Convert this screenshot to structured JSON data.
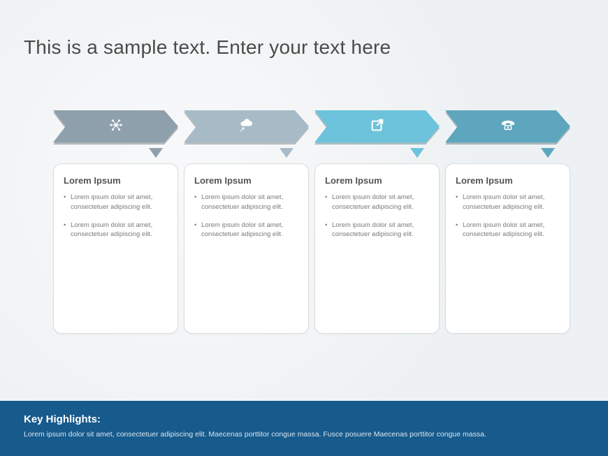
{
  "title": "This is a sample text. Enter your text here",
  "colors": {
    "step1": "#8ea0ab",
    "step2": "#a7bbc7",
    "step3": "#6cc3db",
    "step4": "#5ea6bd",
    "footer_bg": "#175a8c"
  },
  "steps": [
    {
      "icon": "network-icon",
      "heading": "Lorem Ipsum",
      "bullets": [
        "Lorem ipsum dolor sit amet, consectetuer adipiscing elit.",
        "Lorem ipsum dolor sit amet, consectetuer adipiscing elit."
      ]
    },
    {
      "icon": "thought-cloud-icon",
      "heading": "Lorem Ipsum",
      "bullets": [
        "Lorem ipsum dolor sit amet, consectetuer adipiscing elit.",
        "Lorem ipsum dolor sit amet, consectetuer adipiscing elit."
      ]
    },
    {
      "icon": "share-icon",
      "heading": "Lorem Ipsum",
      "bullets": [
        "Lorem ipsum dolor sit amet, consectetuer adipiscing elit.",
        "Lorem ipsum dolor sit amet, consectetuer adipiscing elit."
      ]
    },
    {
      "icon": "phone-icon",
      "heading": "Lorem Ipsum",
      "bullets": [
        "Lorem ipsum dolor sit amet, consectetuer adipiscing elit.",
        "Lorem ipsum dolor sit amet, consectetuer adipiscing elit."
      ]
    }
  ],
  "footer": {
    "heading": "Key Highlights:",
    "body": "Lorem ipsum dolor sit amet, consectetuer adipiscing elit. Maecenas porttitor congue massa. Fusce posuere Maecenas porttitor congue massa."
  }
}
